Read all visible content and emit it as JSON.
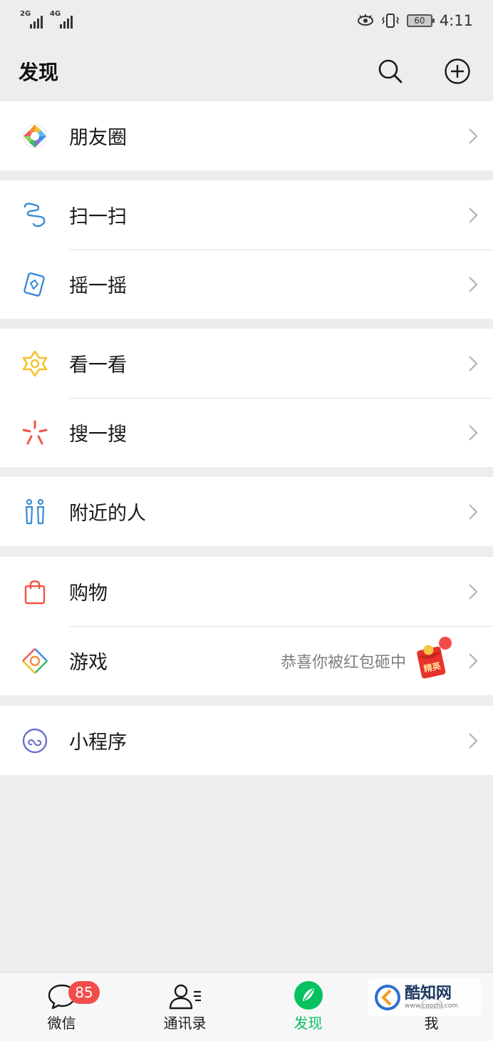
{
  "status_bar": {
    "signal_1_tag": "2G",
    "signal_2_tag": "4G",
    "battery": "60",
    "time": "4:11"
  },
  "header": {
    "title": "发现",
    "search_icon": "search-icon",
    "add_icon": "plus-circle-icon"
  },
  "groups": [
    {
      "items": [
        {
          "label": "朋友圈",
          "icon": "moments-icon"
        }
      ]
    },
    {
      "items": [
        {
          "label": "扫一扫",
          "icon": "scan-icon"
        },
        {
          "label": "摇一摇",
          "icon": "shake-icon"
        }
      ]
    },
    {
      "items": [
        {
          "label": "看一看",
          "icon": "top-stories-icon"
        },
        {
          "label": "搜一搜",
          "icon": "search-discover-icon"
        }
      ]
    },
    {
      "items": [
        {
          "label": "附近的人",
          "icon": "people-nearby-icon"
        }
      ]
    },
    {
      "items": [
        {
          "label": "购物",
          "icon": "shopping-bag-icon"
        },
        {
          "label": "游戏",
          "icon": "games-icon",
          "extra": "恭喜你被红包砸中",
          "extra_badge": "精英"
        }
      ]
    },
    {
      "items": [
        {
          "label": "小程序",
          "icon": "mini-programs-icon"
        }
      ]
    }
  ],
  "tabbar": {
    "tabs": [
      {
        "label": "微信",
        "badge": "85"
      },
      {
        "label": "通讯录"
      },
      {
        "label": "发现",
        "active": true
      },
      {
        "label": "我"
      }
    ]
  },
  "watermark": {
    "name": "酷知网",
    "url": "www.coozhi.com"
  },
  "colors": {
    "accent": "#07c160",
    "badge": "#f14d4b",
    "background": "#ededed"
  }
}
